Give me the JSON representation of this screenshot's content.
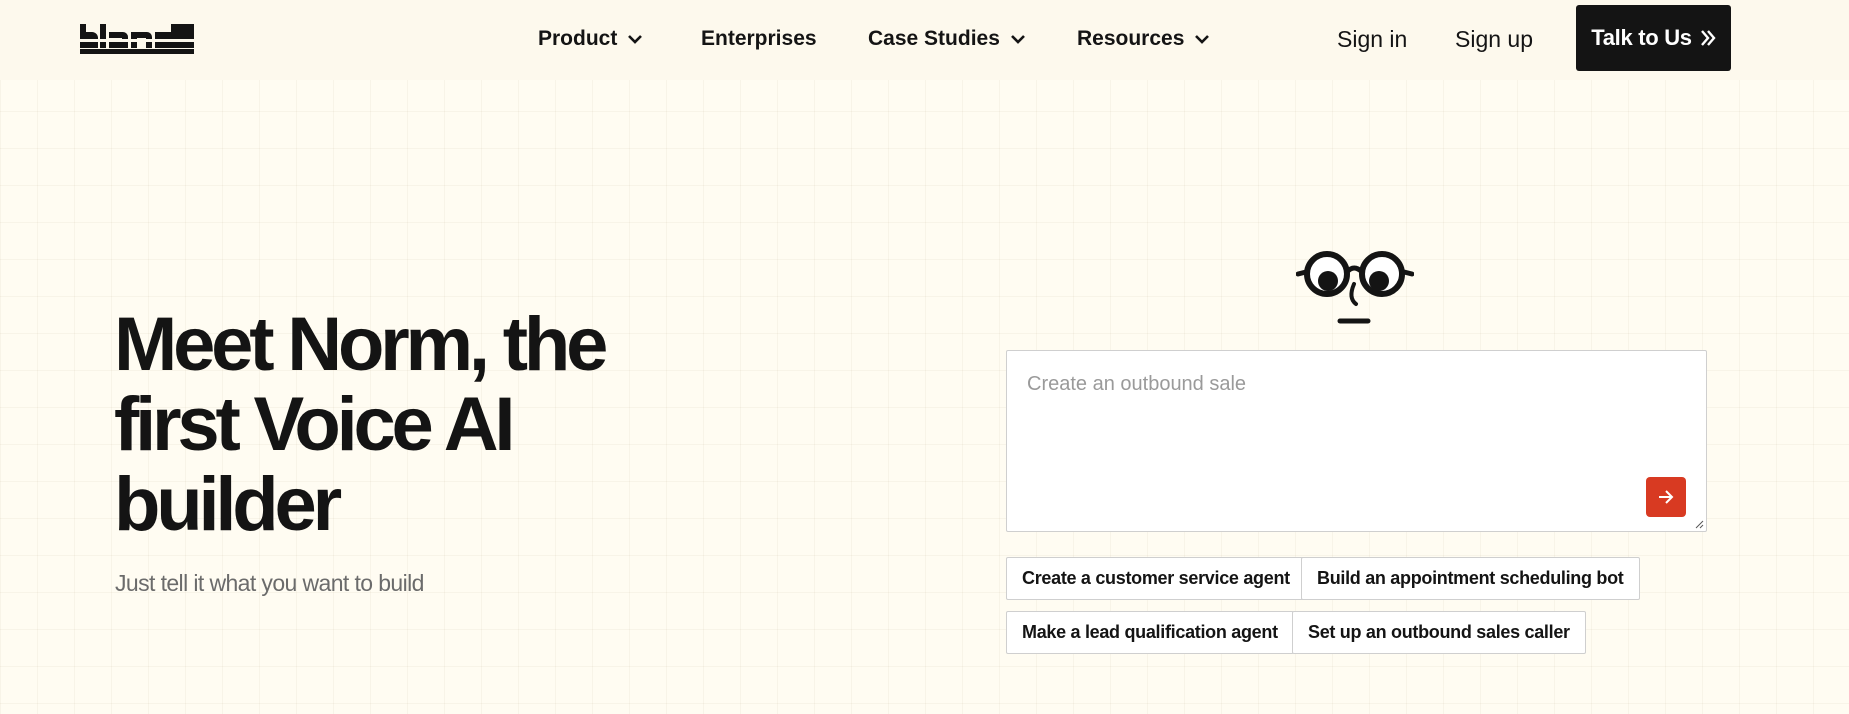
{
  "brand": {
    "logo_text": "bland"
  },
  "nav": {
    "items": [
      {
        "label": "Product",
        "has_dropdown": true
      },
      {
        "label": "Enterprises",
        "has_dropdown": false
      },
      {
        "label": "Case Studies",
        "has_dropdown": true
      },
      {
        "label": "Resources",
        "has_dropdown": true
      }
    ],
    "sign_in": "Sign in",
    "sign_up": "Sign up",
    "cta": "Talk to Us"
  },
  "hero": {
    "title": "Meet Norm, the first Voice AI builder",
    "subtitle": "Just tell it what you want to build"
  },
  "prompt": {
    "placeholder": "Create an outbound sale",
    "value": ""
  },
  "suggestions": [
    "Create a customer service agent",
    "Build an appointment scheduling bot",
    "Make a lead qualification agent",
    "Set up an outbound sales caller"
  ],
  "colors": {
    "background": "#fffcf2",
    "nav_background": "#fdf9ed",
    "text": "#141414",
    "accent": "#d83a22",
    "muted": "#6b6b6b"
  }
}
